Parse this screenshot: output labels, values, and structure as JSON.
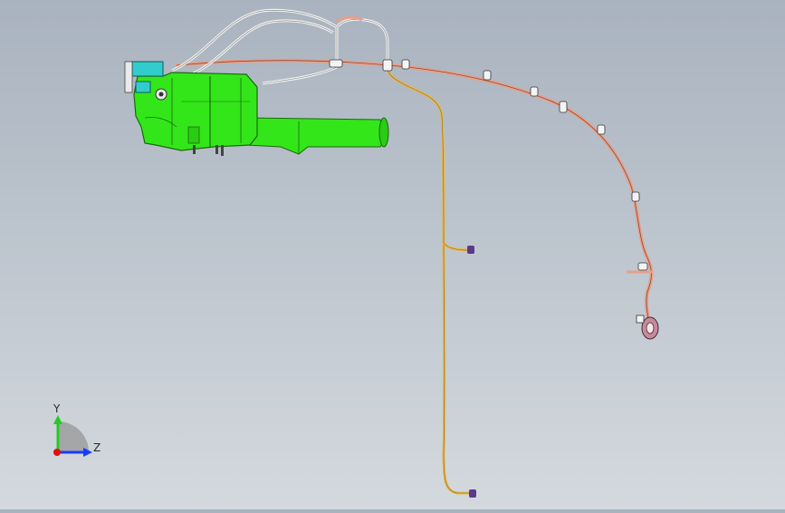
{
  "viewport": {
    "background_top": "#a9b3bf",
    "background_bottom": "#d4d9de"
  },
  "model": {
    "tank_color": "#33e61a",
    "reservoir_color": "#33cccc",
    "hose_main_color": "#e6a08a",
    "hose_white_color": "#f2f2f2",
    "hose_yellow_color": "#e6b84d",
    "connector_color": "#5a3a8a"
  },
  "triad": {
    "y_label": "Y",
    "z_label": "Z",
    "y_color": "#22cc22",
    "z_color": "#1a3cff",
    "origin_color": "#e01010"
  }
}
